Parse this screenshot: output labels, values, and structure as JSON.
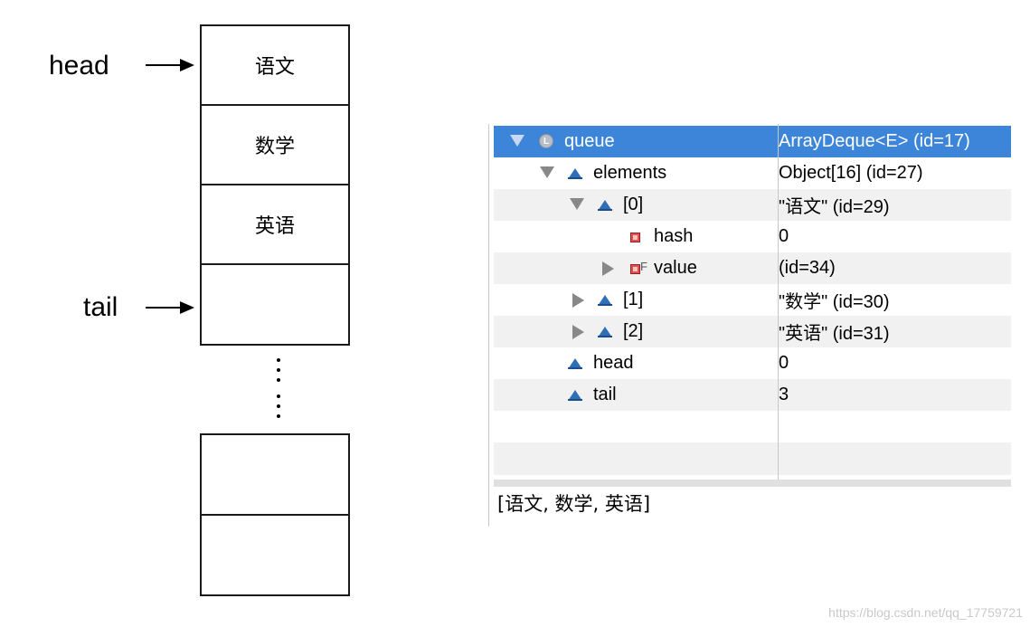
{
  "diagram": {
    "head_label": "head",
    "tail_label": "tail",
    "cells": [
      "语文",
      "数学",
      "英语",
      "",
      "",
      ""
    ]
  },
  "debugger": {
    "rows": [
      {
        "name": "queue",
        "value": "ArrayDeque<E>  (id=17)",
        "icon": "local-variable-icon",
        "expander": "expanded"
      },
      {
        "name": "elements",
        "value": "Object[16]  (id=27)",
        "icon": "field-icon",
        "expander": "expanded"
      },
      {
        "name": "[0]",
        "value": "\"语文\" (id=29)",
        "icon": "field-icon",
        "expander": "expanded"
      },
      {
        "name": "hash",
        "value": "0",
        "icon": "private-field-icon",
        "expander": "none"
      },
      {
        "name": "value",
        "value": "(id=34)",
        "icon": "private-final-field-icon",
        "expander": "collapsed"
      },
      {
        "name": "[1]",
        "value": "\"数学\" (id=30)",
        "icon": "field-icon",
        "expander": "collapsed"
      },
      {
        "name": "[2]",
        "value": "\"英语\" (id=31)",
        "icon": "field-icon",
        "expander": "collapsed"
      },
      {
        "name": "head",
        "value": "0",
        "icon": "field-icon",
        "expander": "none"
      },
      {
        "name": "tail",
        "value": "3",
        "icon": "field-icon",
        "expander": "none"
      }
    ],
    "detail_text": "[语文, 数学, 英语]",
    "selection_color": "#3d85d9"
  },
  "watermark": "https://blog.csdn.net/qq_17759721"
}
